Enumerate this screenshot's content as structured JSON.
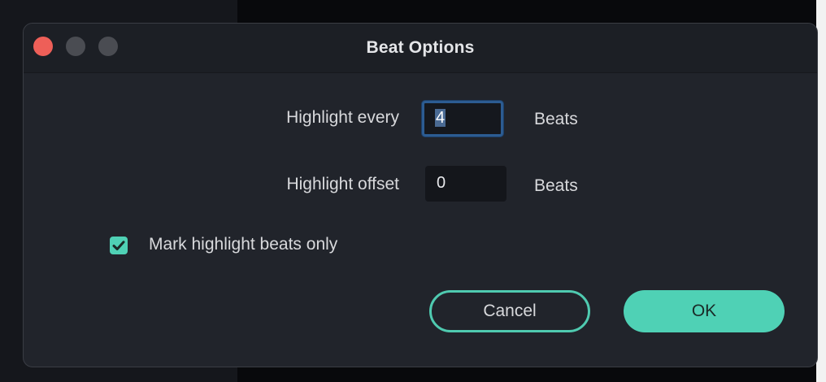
{
  "dialog": {
    "title": "Beat Options",
    "highlight_every": {
      "label": "Highlight every",
      "value": "4",
      "unit": "Beats"
    },
    "highlight_offset": {
      "label": "Highlight offset",
      "value": "0",
      "unit": "Beats"
    },
    "mark_only": {
      "label": "Mark highlight beats only",
      "checked": true
    },
    "cancel_label": "Cancel",
    "ok_label": "OK"
  },
  "colors": {
    "accent": "#4fd1b5",
    "close_button": "#ee5f58",
    "dialog_bg": "#21242b",
    "focus_ring": "#2c5c92"
  },
  "icons": {
    "checkbox": "checkmark-icon"
  }
}
